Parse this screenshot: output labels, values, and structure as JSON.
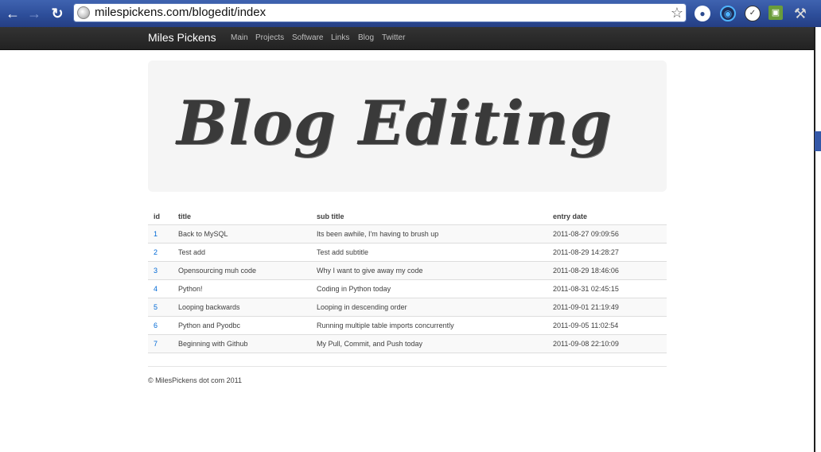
{
  "browser": {
    "url": "milespickens.com/blogedit/index",
    "back_icon": "back-arrow-icon",
    "forward_icon": "forward-arrow-icon",
    "reload_icon": "reload-icon",
    "bookmark_icon": "star-icon",
    "extension_icons": [
      "chat-extension-icon",
      "eye-extension-icon",
      "clock-extension-icon",
      "monitor-extension-icon",
      "wrench-icon"
    ]
  },
  "navbar": {
    "brand": "Miles Pickens",
    "links": [
      "Main",
      "Projects",
      "Software",
      "Links",
      "Blog",
      "Twitter"
    ]
  },
  "hero": {
    "title": "Blog Editing"
  },
  "table": {
    "headers": [
      "id",
      "title",
      "sub title",
      "entry date"
    ],
    "rows": [
      {
        "id": "1",
        "title": "Back to MySQL",
        "sub_title": "Its been awhile, I'm having to brush up",
        "entry_date": "2011-08-27 09:09:56"
      },
      {
        "id": "2",
        "title": "Test add",
        "sub_title": "Test add subtitle",
        "entry_date": "2011-08-29 14:28:27"
      },
      {
        "id": "3",
        "title": "Opensourcing muh code",
        "sub_title": "Why I want to give away my code",
        "entry_date": "2011-08-29 18:46:06"
      },
      {
        "id": "4",
        "title": "Python!",
        "sub_title": "Coding in Python today",
        "entry_date": "2011-08-31 02:45:15"
      },
      {
        "id": "5",
        "title": "Looping backwards",
        "sub_title": "Looping in descending order",
        "entry_date": "2011-09-01 21:19:49"
      },
      {
        "id": "6",
        "title": "Python and Pyodbc",
        "sub_title": "Running multiple table imports concurrently",
        "entry_date": "2011-09-05 11:02:54"
      },
      {
        "id": "7",
        "title": "Beginning with Github",
        "sub_title": "My Pull, Commit, and Push today",
        "entry_date": "2011-09-08 22:10:09"
      }
    ]
  },
  "footer": {
    "text": "© MilesPickens dot com 2011"
  }
}
